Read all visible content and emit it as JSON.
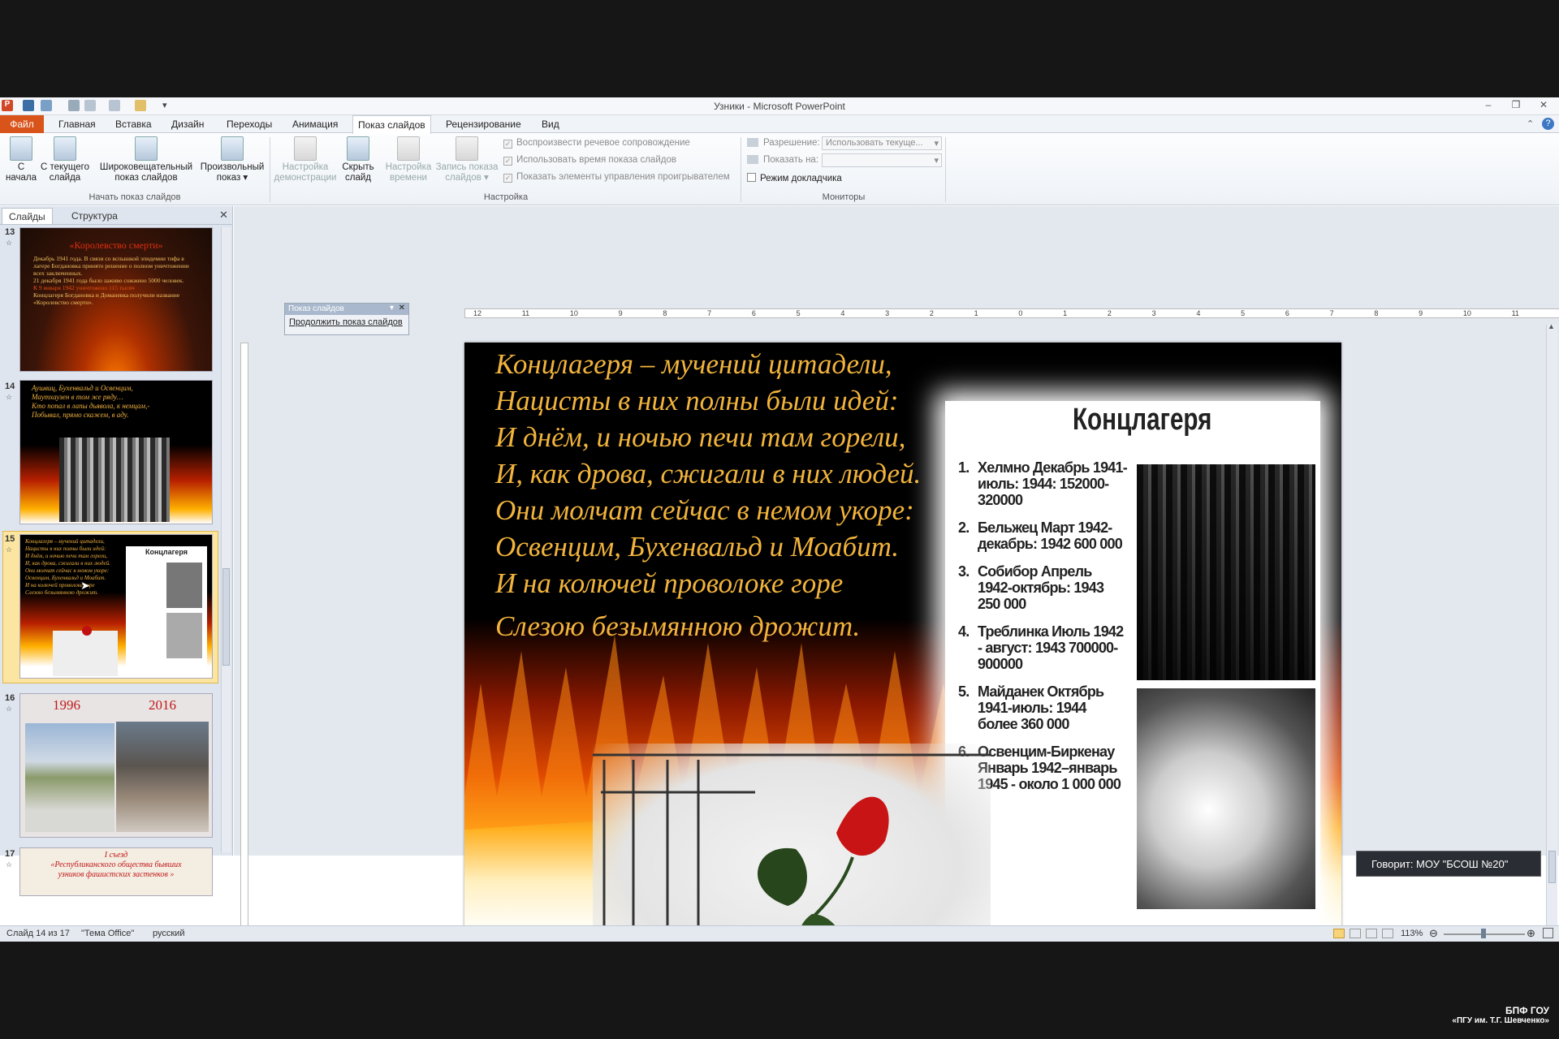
{
  "window": {
    "title": "Узники - Microsoft PowerPoint"
  },
  "tabs": {
    "file": "Файл",
    "home": "Главная",
    "insert": "Вставка",
    "design": "Дизайн",
    "transitions": "Переходы",
    "animation": "Анимация",
    "slideshow": "Показ слайдов",
    "review": "Рецензирование",
    "view": "Вид"
  },
  "ribbon": {
    "from_start": [
      "С",
      "начала"
    ],
    "from_current": [
      "С текущего",
      "слайда"
    ],
    "broadcast": [
      "Широковещательный",
      "показ слайдов"
    ],
    "custom": [
      "Произвольный",
      "показ ▾"
    ],
    "group_start": "Начать показ слайдов",
    "setup": [
      "Настройка",
      "демонстрации"
    ],
    "hide": [
      "Скрыть",
      "слайд"
    ],
    "timings": [
      "Настройка",
      "времени"
    ],
    "record": [
      "Запись показа",
      "слайдов ▾"
    ],
    "chk_narration": "Воспроизвести речевое сопровождение",
    "chk_timings": "Использовать время показа слайдов",
    "chk_controls": "Показать элементы управления проигрывателем",
    "group_setup": "Настройка",
    "resolution_label": "Разрешение:",
    "resolution_value": "Использовать текуще...",
    "show_on_label": "Показать на:",
    "show_on_value": "",
    "presenter_view": "Режим докладчика",
    "group_monitors": "Мониторы"
  },
  "left_pane": {
    "tab_slides": "Слайды",
    "tab_outline": "Структура",
    "thumbs": [
      {
        "num": "13",
        "title": "«Королевство смерти»",
        "lines": [
          "Декабрь 1941 года. В связи со вспышкой эпидемии тифа в лагере Богдановка принято решение о полном уничтожении всех заключенных.",
          "21 декабря 1941 года было заживо сожжено 5000 человек.",
          "К 9 января 1942 уничтожено 115 тысяч",
          "Концлагеря Богдановка и Доманевка получили название «Королевство смерти»."
        ]
      },
      {
        "num": "14",
        "lines": [
          "Аушвиц, Бухенвальд и Освенцим,",
          "Маутхаузен в том же ряду…",
          "Кто попал в лапы дьявола, к немцам,-",
          "Побывал, прямо скажем, в аду."
        ]
      },
      {
        "num": "15"
      },
      {
        "num": "16",
        "year1": "1996",
        "year2": "2016"
      },
      {
        "num": "17",
        "lines": [
          "I съезд",
          "«Республиканского общества бывших",
          "узников фашистских застенков »"
        ]
      }
    ]
  },
  "floating_toolbar": {
    "title": "Показ слайдов",
    "button": "Продолжить показ слайдов"
  },
  "ruler": {
    "marks": [
      "12",
      "11",
      "10",
      "9",
      "8",
      "7",
      "6",
      "5",
      "4",
      "3",
      "2",
      "1",
      "0",
      "1",
      "2",
      "3",
      "4",
      "5",
      "6",
      "7",
      "8",
      "9",
      "10",
      "11",
      "12"
    ]
  },
  "slide": {
    "poem": [
      "Концлагеря – мучений цитадели,",
      "Нацисты в них полны были идей:",
      "И днём, и ночью печи там горели,",
      "И, как дрова, сжигали в них людей.",
      "Они молчат сейчас в немом укоре:",
      "Освенцим, Бухенвальд и Моабит.",
      "И на колючей проволоке горе",
      "Слезою безымянною дрожит."
    ],
    "box_title": "Концлагеря",
    "camps": [
      {
        "n": "1.",
        "text": "Хелмно Декабрь 1941-июль: 1944: 152000-320000"
      },
      {
        "n": "2.",
        "text": "Бельжец Март 1942-декабрь: 1942 600 000"
      },
      {
        "n": "3.",
        "text": "Собибор Апрель 1942-октябрь: 1943 250 000"
      },
      {
        "n": "4.",
        "text": "Треблинка Июль 1942 - август: 1943 700000-900000"
      },
      {
        "n": "5.",
        "text": "Майданек Октябрь 1941-июль: 1944 более 360 000"
      },
      {
        "n": "6.",
        "text": "Освенцим-Биркенау Январь 1942–январь 1945 - около 1 000 000"
      }
    ]
  },
  "tooltip": {
    "speaker": "Говорит: МОУ \"БСОШ №20\""
  },
  "status": {
    "slide": "Слайд 14 из 17",
    "theme": "\"Тема Office\"",
    "lang": "русский",
    "zoom": "113%"
  },
  "watermark": {
    "line1": "БПФ ГОУ",
    "line2": "«ПГУ им. Т.Г. Шевченко»"
  }
}
